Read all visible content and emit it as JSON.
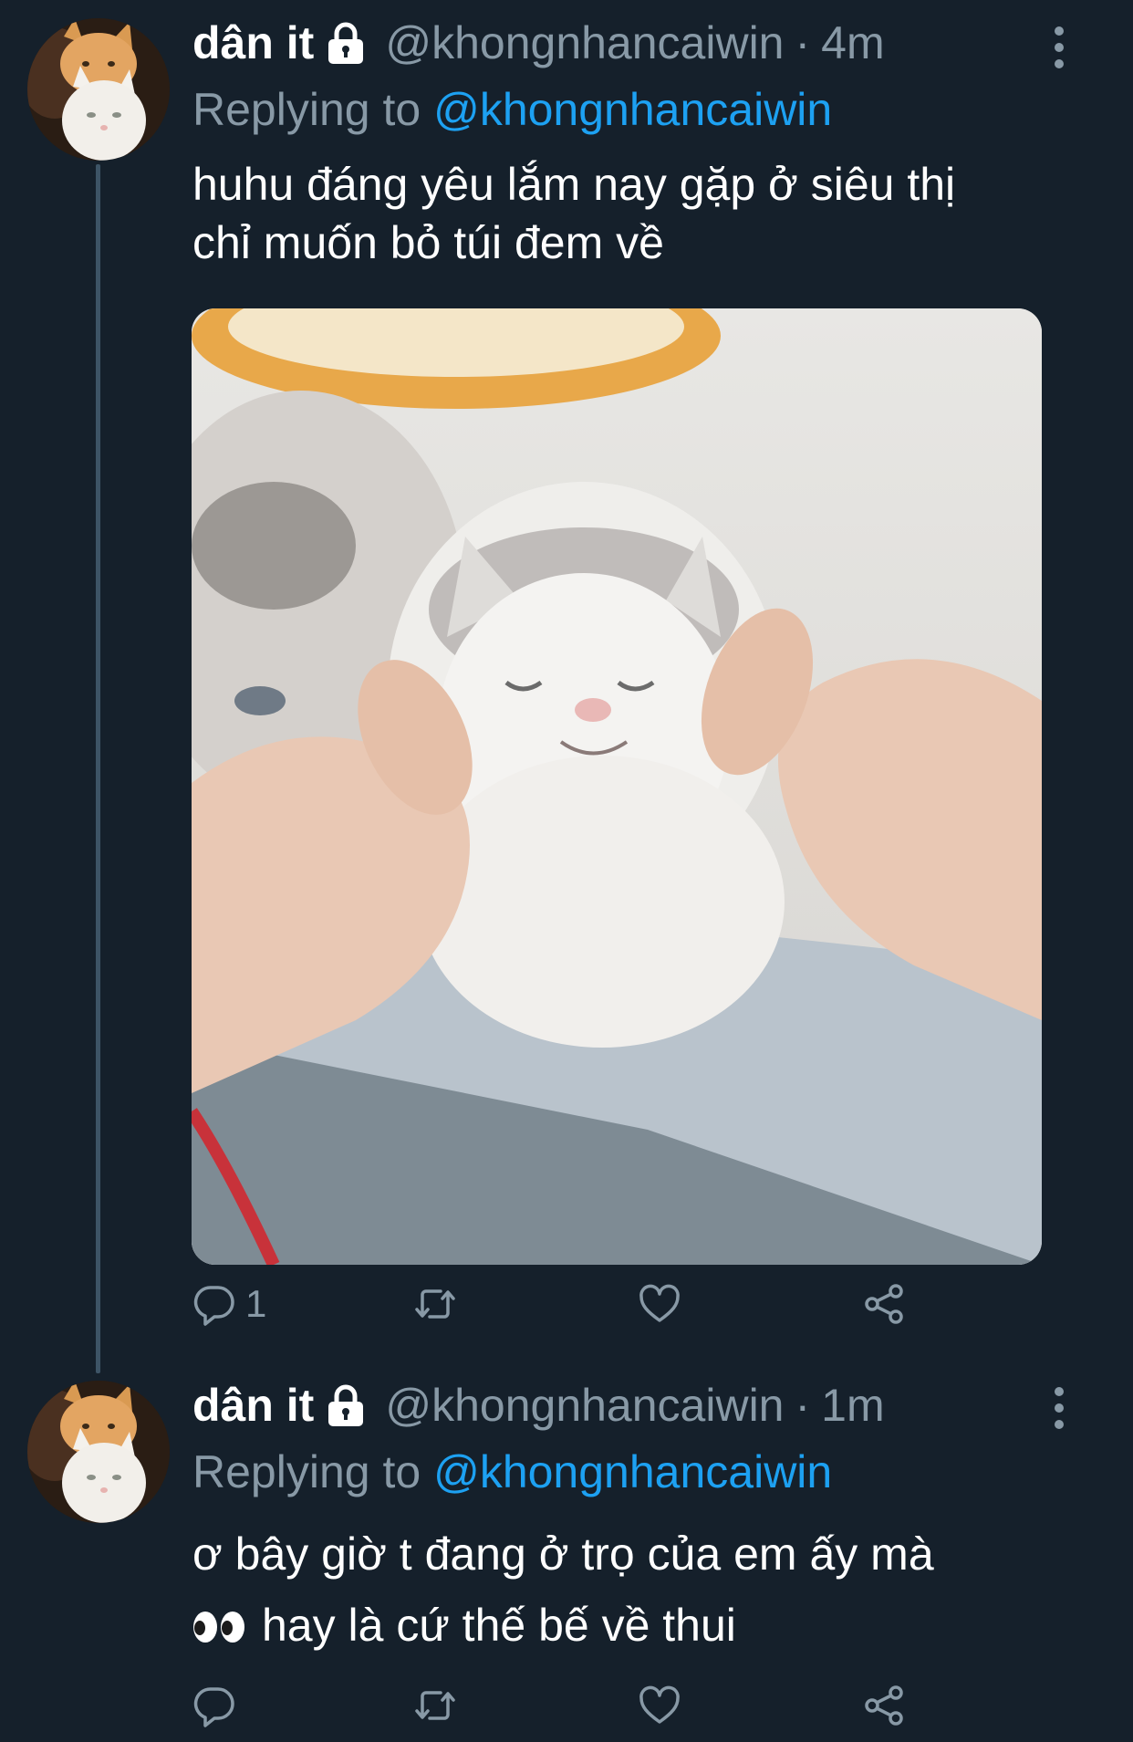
{
  "tweets": [
    {
      "name": "dân it",
      "handle": "@khongnhancaiwin",
      "separator": "·",
      "time": "4m",
      "replying_prefix": "Replying to",
      "replying_to": "@khongnhancaiwin",
      "text_line1": "huhu đáng yêu lắm nay gặp ở siêu thị",
      "text_line2": "chỉ muốn bỏ túi đem về",
      "reply_count": "1"
    },
    {
      "name": "dân it",
      "handle": "@khongnhancaiwin",
      "separator": "·",
      "time": "1m",
      "replying_prefix": "Replying to",
      "replying_to": "@khongnhancaiwin",
      "text_line1": "ơ bây giờ t đang ở trọ của em ấy mà",
      "text_line2": "hay là cứ thế bế về thui",
      "reply_count": ""
    }
  ],
  "colors": {
    "background": "#15202b",
    "secondary_text": "#8899a6",
    "link": "#1da1f2",
    "thread_line": "#3d5466"
  },
  "icons": [
    "lock-icon",
    "more-icon",
    "reply-icon",
    "retweet-icon",
    "like-icon",
    "share-icon",
    "eyes-emoji"
  ]
}
